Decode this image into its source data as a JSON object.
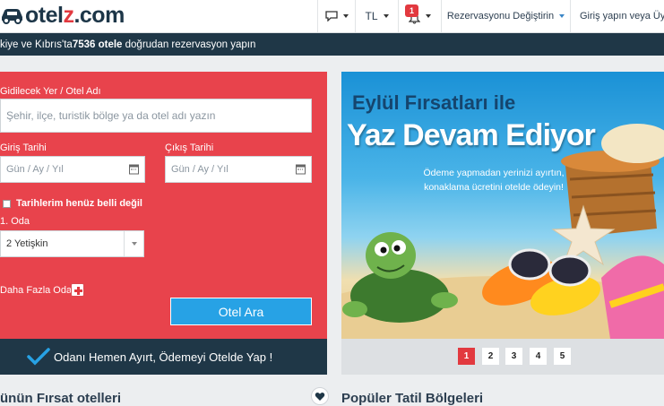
{
  "header": {
    "logo_text_main": "otel",
    "logo_text_accent": "z",
    "logo_text_suffix": ".com",
    "chat_icon": "chat-icon",
    "currency": "TL",
    "notifications_count": "1",
    "manage_booking": "Rezervasyonu Değiştirin",
    "login": "Giriş yapın veya Üye Ol"
  },
  "infobar": {
    "prefix": "kiye ve Kıbrıs'ta ",
    "count": "7536 otele",
    "suffix": " doğrudan rezervasyon yapın"
  },
  "form": {
    "destination_label": "Gidilecek Yer / Otel Adı",
    "destination_placeholder": "Şehir, ilçe, turistik bölge ya da otel adı yazın",
    "checkin_label": "Giriş Tarihi",
    "checkin_placeholder": "Gün / Ay / Yıl",
    "checkout_label": "Çıkış Tarihi",
    "checkout_placeholder": "Gün / Ay / Yıl",
    "dates_unknown": "Tarihlerim henüz belli değil",
    "room_label": "1. Oda",
    "guests_value": "2 Yetişkin",
    "more_rooms": "Daha Fazla Oda",
    "search_button": "Otel Ara"
  },
  "promo_strip": {
    "text": "Odanı Hemen Ayırt, Ödemeyi Otelde Yap !"
  },
  "banner": {
    "line1": "Eylül Fırsatları ile",
    "line2": "Yaz Devam Ediyor",
    "sub1": "Ödeme yapmadan yerinizi ayırtın,",
    "sub2": "konaklama ücretini otelde ödeyin!"
  },
  "carousel": {
    "pages": [
      "1",
      "2",
      "3",
      "4",
      "5"
    ],
    "active": "1"
  },
  "sections": {
    "left_title": "ünün Fırsat otelleri",
    "right_title": "Popüler Tatil Bölgeleri"
  },
  "colors": {
    "brand_red": "#e2393f",
    "navy": "#1f3747",
    "button_blue": "#27a2e5"
  }
}
